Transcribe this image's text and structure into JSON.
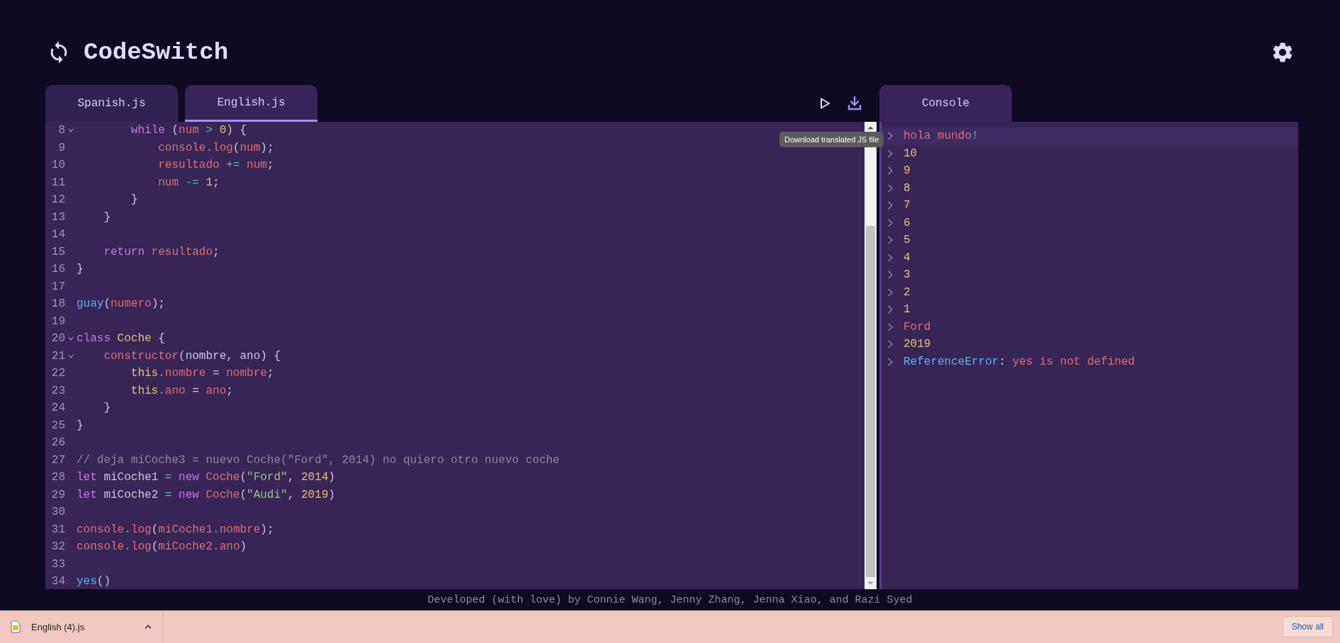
{
  "app": {
    "title": "CodeSwitch"
  },
  "editor_tabs": [
    {
      "label": "Spanish.js",
      "selected": false
    },
    {
      "label": "English.js",
      "selected": true
    }
  ],
  "tooltip": "Download translated JS file",
  "console_tab": {
    "label": "Console"
  },
  "code_lines": [
    {
      "number": "8",
      "fold": true,
      "tokens": [
        {
          "kind": "kw",
          "text": "        while"
        },
        {
          "kind": "plain",
          "text": " ("
        },
        {
          "kind": "var",
          "text": "num"
        },
        {
          "kind": "op",
          "text": " > "
        },
        {
          "kind": "num",
          "text": "0"
        },
        {
          "kind": "plain",
          "text": ") {"
        }
      ]
    },
    {
      "number": "9",
      "fold": false,
      "tokens": [
        {
          "kind": "var",
          "text": "            console"
        },
        {
          "kind": "op",
          "text": "."
        },
        {
          "kind": "var",
          "text": "log"
        },
        {
          "kind": "plain",
          "text": "("
        },
        {
          "kind": "var",
          "text": "num"
        },
        {
          "kind": "plain",
          "text": ");"
        }
      ]
    },
    {
      "number": "10",
      "fold": false,
      "tokens": [
        {
          "kind": "var",
          "text": "            resultado"
        },
        {
          "kind": "op",
          "text": " += "
        },
        {
          "kind": "var",
          "text": "num"
        },
        {
          "kind": "plain",
          "text": ";"
        }
      ]
    },
    {
      "number": "11",
      "fold": false,
      "tokens": [
        {
          "kind": "var",
          "text": "            num"
        },
        {
          "kind": "op",
          "text": " -= "
        },
        {
          "kind": "num",
          "text": "1"
        },
        {
          "kind": "plain",
          "text": ";"
        }
      ]
    },
    {
      "number": "12",
      "fold": false,
      "tokens": [
        {
          "kind": "plain",
          "text": "        }"
        }
      ]
    },
    {
      "number": "13",
      "fold": false,
      "tokens": [
        {
          "kind": "plain",
          "text": "    }"
        }
      ]
    },
    {
      "number": "14",
      "fold": false
    },
    {
      "number": "15",
      "fold": false,
      "tokens": [
        {
          "kind": "kw",
          "text": "    return"
        },
        {
          "kind": "var",
          "text": " resultado"
        },
        {
          "kind": "plain",
          "text": ";"
        }
      ]
    },
    {
      "number": "16",
      "fold": false,
      "tokens": [
        {
          "kind": "plain",
          "text": "}"
        }
      ]
    },
    {
      "number": "17",
      "fold": false
    },
    {
      "number": "18",
      "fold": false,
      "tokens": [
        {
          "kind": "fn",
          "text": "guay"
        },
        {
          "kind": "plain",
          "text": "("
        },
        {
          "kind": "var",
          "text": "numero"
        },
        {
          "kind": "plain",
          "text": ");"
        }
      ]
    },
    {
      "number": "19",
      "fold": false
    },
    {
      "number": "20",
      "fold": true,
      "tokens": [
        {
          "kind": "kw",
          "text": "class"
        },
        {
          "kind": "cls",
          "text": " Coche"
        },
        {
          "kind": "plain",
          "text": " {"
        }
      ]
    },
    {
      "number": "21",
      "fold": true,
      "tokens": [
        {
          "kind": "var",
          "text": "    constructor"
        },
        {
          "kind": "plain",
          "text": "(nombre, ano) {"
        }
      ]
    },
    {
      "number": "22",
      "fold": false,
      "tokens": [
        {
          "kind": "cls",
          "text": "        this"
        },
        {
          "kind": "op",
          "text": "."
        },
        {
          "kind": "var",
          "text": "nombre"
        },
        {
          "kind": "plain",
          "text": " = "
        },
        {
          "kind": "var",
          "text": "nombre"
        },
        {
          "kind": "plain",
          "text": ";"
        }
      ]
    },
    {
      "number": "23",
      "fold": false,
      "tokens": [
        {
          "kind": "cls",
          "text": "        this"
        },
        {
          "kind": "op",
          "text": "."
        },
        {
          "kind": "var",
          "text": "ano"
        },
        {
          "kind": "plain",
          "text": " = "
        },
        {
          "kind": "var",
          "text": "ano"
        },
        {
          "kind": "plain",
          "text": ";"
        }
      ]
    },
    {
      "number": "24",
      "fold": false,
      "tokens": [
        {
          "kind": "plain",
          "text": "    }"
        }
      ]
    },
    {
      "number": "25",
      "fold": false,
      "tokens": [
        {
          "kind": "plain",
          "text": "}"
        }
      ]
    },
    {
      "number": "26",
      "fold": false
    },
    {
      "number": "27",
      "fold": false,
      "tokens": [
        {
          "kind": "comment",
          "text": "// deja miCoche3 = nuevo Coche(\"Ford\", 2014) no quiero otro nuevo coche"
        }
      ]
    },
    {
      "number": "28",
      "fold": false,
      "tokens": [
        {
          "kind": "kw",
          "text": "let"
        },
        {
          "kind": "plain",
          "text": " miCoche1 "
        },
        {
          "kind": "op",
          "text": "="
        },
        {
          "kind": "kw",
          "text": " new"
        },
        {
          "kind": "var",
          "text": " Coche"
        },
        {
          "kind": "plain",
          "text": "("
        },
        {
          "kind": "str",
          "text": "\"Ford\""
        },
        {
          "kind": "plain",
          "text": ", "
        },
        {
          "kind": "num",
          "text": "2014"
        },
        {
          "kind": "plain",
          "text": ")"
        }
      ]
    },
    {
      "number": "29",
      "fold": false,
      "tokens": [
        {
          "kind": "kw",
          "text": "let"
        },
        {
          "kind": "plain",
          "text": " miCoche2 "
        },
        {
          "kind": "op",
          "text": "="
        },
        {
          "kind": "kw",
          "text": " new"
        },
        {
          "kind": "var",
          "text": " Coche"
        },
        {
          "kind": "plain",
          "text": "("
        },
        {
          "kind": "str",
          "text": "\"Audi\""
        },
        {
          "kind": "plain",
          "text": ", "
        },
        {
          "kind": "num",
          "text": "2019"
        },
        {
          "kind": "plain",
          "text": ")"
        }
      ]
    },
    {
      "number": "30",
      "fold": false
    },
    {
      "number": "31",
      "fold": false,
      "tokens": [
        {
          "kind": "var",
          "text": "console"
        },
        {
          "kind": "op",
          "text": "."
        },
        {
          "kind": "var",
          "text": "log"
        },
        {
          "kind": "plain",
          "text": "("
        },
        {
          "kind": "var",
          "text": "miCoche1"
        },
        {
          "kind": "op",
          "text": "."
        },
        {
          "kind": "var",
          "text": "nombre"
        },
        {
          "kind": "plain",
          "text": ");"
        }
      ]
    },
    {
      "number": "32",
      "fold": false,
      "tokens": [
        {
          "kind": "var",
          "text": "console"
        },
        {
          "kind": "op",
          "text": "."
        },
        {
          "kind": "var",
          "text": "log"
        },
        {
          "kind": "plain",
          "text": "("
        },
        {
          "kind": "var",
          "text": "miCoche2"
        },
        {
          "kind": "op",
          "text": "."
        },
        {
          "kind": "var",
          "text": "ano"
        },
        {
          "kind": "plain",
          "text": ")"
        }
      ]
    },
    {
      "number": "33",
      "fold": false
    },
    {
      "number": "34",
      "fold": false,
      "tokens": [
        {
          "kind": "fn",
          "text": "yes"
        },
        {
          "kind": "plain",
          "text": "()"
        }
      ]
    }
  ],
  "console_rows": [
    {
      "selected": true,
      "tokens": [
        {
          "kind": "var",
          "text": "hola mundo"
        },
        {
          "kind": "op",
          "text": "!"
        }
      ]
    },
    {
      "selected": false,
      "tokens": [
        {
          "kind": "num",
          "text": "10"
        }
      ]
    },
    {
      "selected": false,
      "tokens": [
        {
          "kind": "num",
          "text": "9"
        }
      ]
    },
    {
      "selected": false,
      "tokens": [
        {
          "kind": "num",
          "text": "8"
        }
      ]
    },
    {
      "selected": false,
      "tokens": [
        {
          "kind": "num",
          "text": "7"
        }
      ]
    },
    {
      "selected": false,
      "tokens": [
        {
          "kind": "num",
          "text": "6"
        }
      ]
    },
    {
      "selected": false,
      "tokens": [
        {
          "kind": "num",
          "text": "5"
        }
      ]
    },
    {
      "selected": false,
      "tokens": [
        {
          "kind": "num",
          "text": "4"
        }
      ]
    },
    {
      "selected": false,
      "tokens": [
        {
          "kind": "num",
          "text": "3"
        }
      ]
    },
    {
      "selected": false,
      "tokens": [
        {
          "kind": "num",
          "text": "2"
        }
      ]
    },
    {
      "selected": false,
      "tokens": [
        {
          "kind": "num",
          "text": "1"
        }
      ]
    },
    {
      "selected": false,
      "tokens": [
        {
          "kind": "var",
          "text": "Ford"
        }
      ]
    },
    {
      "selected": false,
      "tokens": [
        {
          "kind": "num",
          "text": "2019"
        }
      ]
    },
    {
      "selected": false,
      "tokens": [
        {
          "kind": "fn",
          "text": "ReferenceError"
        },
        {
          "kind": "plain",
          "text": ": "
        },
        {
          "kind": "var",
          "text": "yes is not defined"
        }
      ]
    }
  ],
  "footer": "Developed (with love) by Connie Wang, Jenny Zhang, Jenna Xiao, and Razi Syed",
  "download_bar": {
    "file": "English (4).js",
    "button": "Show all"
  }
}
